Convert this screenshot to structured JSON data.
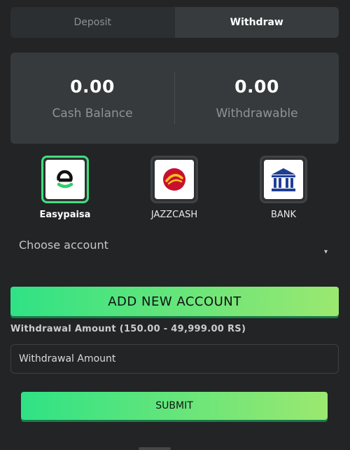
{
  "tabs": [
    {
      "label": "Deposit",
      "active": false
    },
    {
      "label": "Withdraw",
      "active": true
    }
  ],
  "balance": {
    "cash": {
      "value": "0.00",
      "label": "Cash Balance"
    },
    "withdrawable": {
      "value": "0.00",
      "label": "Withdrawable"
    }
  },
  "methods": [
    {
      "label": "Easypaisa",
      "icon": "easypaisa-logo-icon",
      "selected": true
    },
    {
      "label": "JAZZCASH",
      "icon": "jazzcash-logo-icon",
      "selected": false
    },
    {
      "label": "BANK",
      "icon": "bank-icon",
      "selected": false
    }
  ],
  "account_select": {
    "placeholder": "Choose account",
    "caret": "▾"
  },
  "add_account_button": "ADD NEW ACCOUNT",
  "withdrawal": {
    "label": "Withdrawal Amount (150.00 - 49,999.00 RS)",
    "placeholder": "Withdrawal Amount"
  },
  "submit_button": "SUBMIT",
  "colors": {
    "accent_start": "#2fe285",
    "accent_end": "#9be870",
    "background": "#222426",
    "panel": "#363a3c"
  }
}
